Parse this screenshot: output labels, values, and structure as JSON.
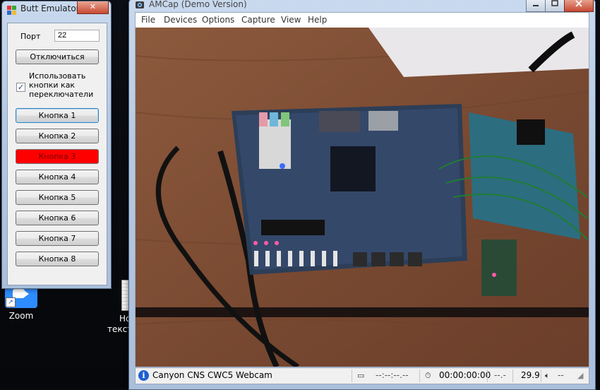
{
  "butt_emulator": {
    "title": "Butt Emulator",
    "close_label": "✕",
    "port_label": "Порт",
    "port_value": "22",
    "disconnect_label": "Отключиться",
    "use_switches_label": "Использовать кнопки как переключатели",
    "use_switches_checked": true,
    "buttons": [
      {
        "label": "Кнопка 1",
        "state": "focused"
      },
      {
        "label": "Кнопка 2",
        "state": "normal"
      },
      {
        "label": "Кнопка 3",
        "state": "active"
      },
      {
        "label": "Кнопка 4",
        "state": "normal"
      },
      {
        "label": "Кнопка 5",
        "state": "normal"
      },
      {
        "label": "Кнопка 6",
        "state": "normal"
      },
      {
        "label": "Кнопка 7",
        "state": "normal"
      },
      {
        "label": "Кнопка 8",
        "state": "normal"
      }
    ],
    "active_color": "#ff0000"
  },
  "amcap": {
    "title": "AMCap (Demo Version)",
    "menu": [
      "File",
      "Devices",
      "Options",
      "Capture",
      "View",
      "Help"
    ],
    "status": {
      "device": "Canyon CNS CWC5 Webcam",
      "frames": "--:--:--.--",
      "time": "00:00:00:00",
      "dropped": "--.-",
      "fps": "29.9"
    }
  },
  "desktop": {
    "zoom_label": "Zoom",
    "text_file_label_line1": "Но",
    "text_file_label_line2": "текст",
    "zoom_color": "#2d8cff"
  }
}
